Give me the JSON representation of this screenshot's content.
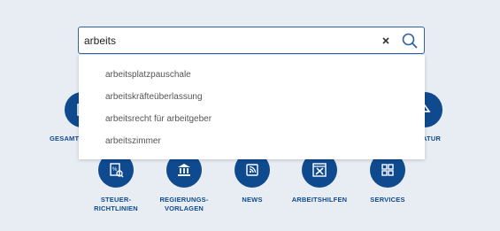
{
  "search": {
    "value": "arbeits",
    "placeholder": ""
  },
  "suggestions": [
    "arbeitsplatzpauschale",
    "arbeitskräfteüberlassung",
    "arbeitsrecht für arbeitgeber",
    "arbeitszimmer"
  ],
  "categories_top": [
    {
      "label": "GESAMTÜ",
      "icon": "document-icon"
    },
    {
      "label": "ATUR",
      "icon": "scale-icon"
    }
  ],
  "categories": [
    {
      "label_line1": "STEUER-",
      "label_line2": "RICHTLINIEN",
      "icon": "percent-document-icon"
    },
    {
      "label_line1": "REGIERUNGS-",
      "label_line2": "VORLAGEN",
      "icon": "government-building-icon"
    },
    {
      "label_line1": "NEWS",
      "label_line2": "",
      "icon": "news-feed-icon"
    },
    {
      "label_line1": "ARBEITSHILFEN",
      "label_line2": "",
      "icon": "tools-icon"
    },
    {
      "label_line1": "SERVICES",
      "label_line2": "",
      "icon": "puzzle-icon"
    }
  ],
  "colors": {
    "accent": "#0f4a8f",
    "background": "#e8edf3",
    "search_border": "#2f61a3"
  }
}
